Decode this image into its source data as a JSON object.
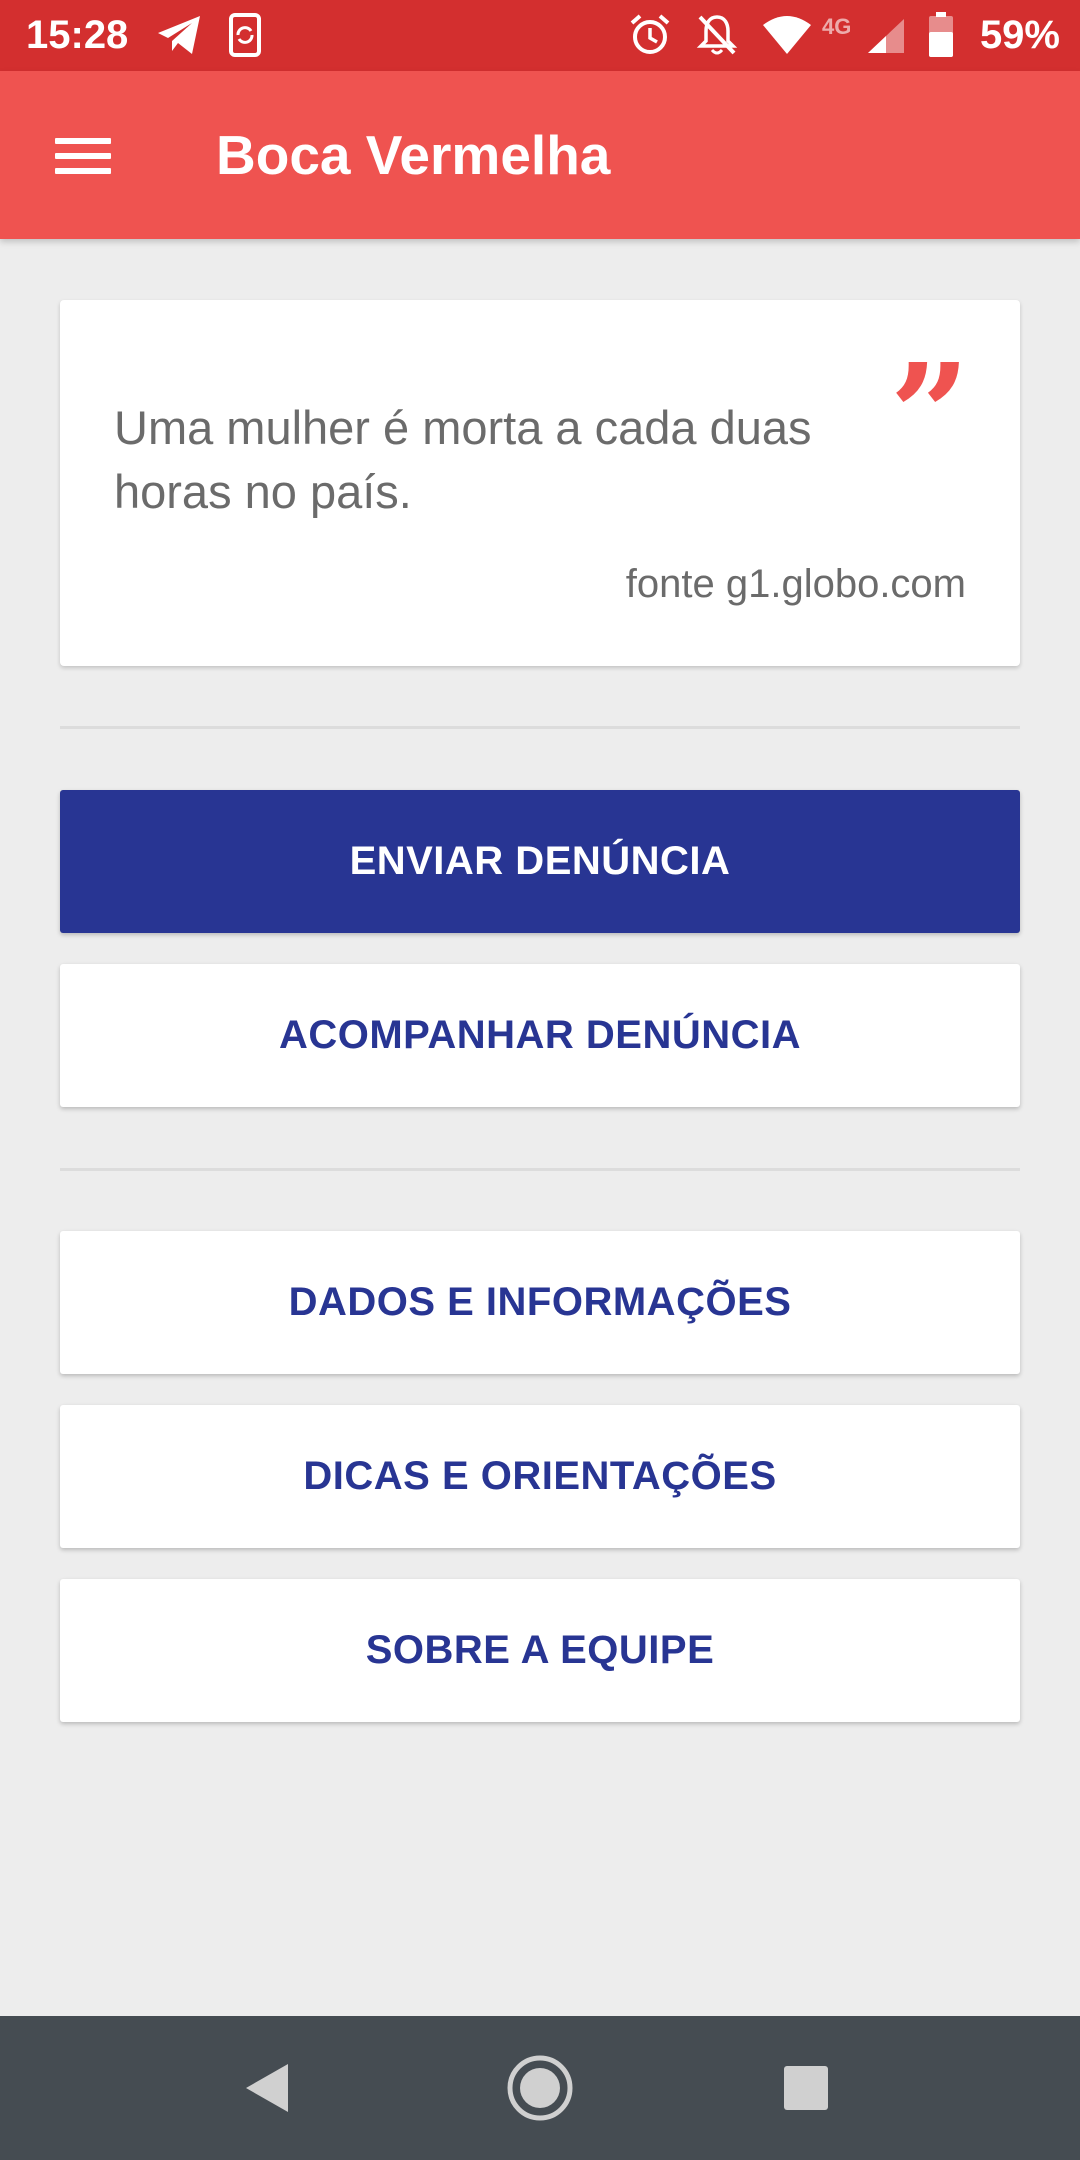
{
  "status_bar": {
    "time": "15:28",
    "network": "4G",
    "battery_percent": "59%",
    "color": "#d32f2f",
    "icons": [
      "telegram-icon",
      "phone-sync-icon",
      "alarm-icon",
      "notifications-off-icon",
      "wifi-icon",
      "cellular-signal-icon",
      "battery-icon"
    ]
  },
  "app_bar": {
    "title": "Boca Vermelha",
    "color": "#ef5350",
    "menu_icon": "hamburger-menu-icon"
  },
  "quote_card": {
    "text": "Uma mulher é morta a cada duas horas no país.",
    "source": "fonte g1.globo.com",
    "quote_icon": "quote-icon",
    "accent_color": "#ef5350"
  },
  "actions": {
    "send_report": "ENVIAR DENÚNCIA",
    "track_report": "ACOMPANHAR DENÚNCIA",
    "data_info": "DADOS E INFORMAÇÕES",
    "tips": "DICAS E ORIENTAÇÕES",
    "about_team": "SOBRE A EQUIPE",
    "primary_color": "#283593"
  },
  "nav_bar": {
    "back_icon": "back-triangle-icon",
    "home_icon": "home-circle-icon",
    "recents_icon": "recents-square-icon"
  }
}
